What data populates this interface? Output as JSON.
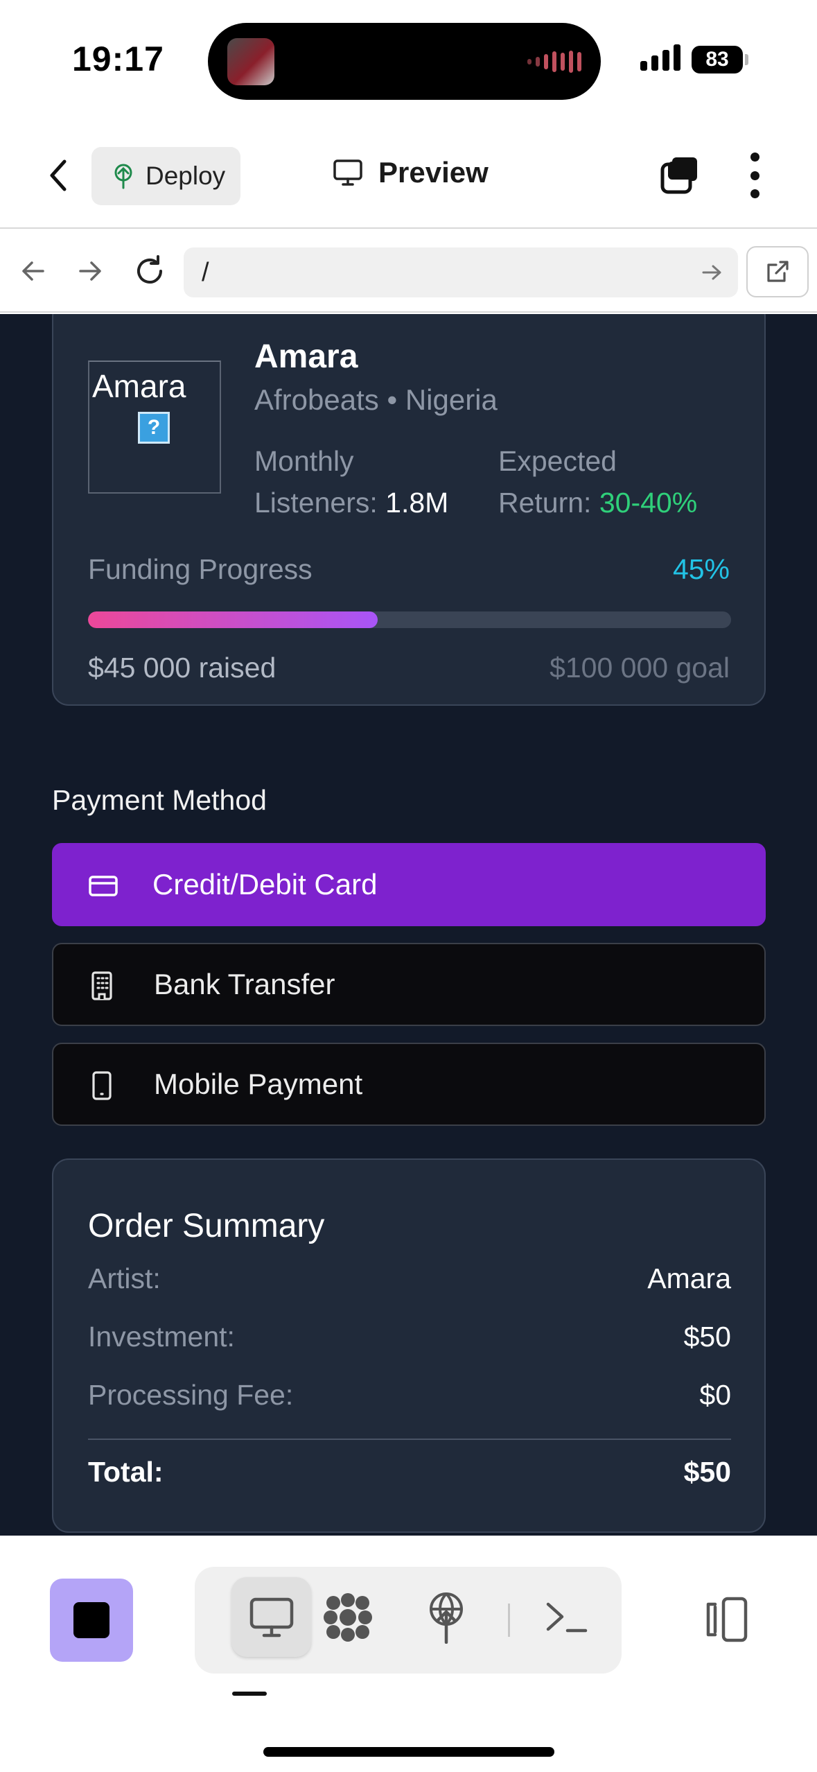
{
  "status_bar": {
    "time": "19:17",
    "battery": "83"
  },
  "app_toolbar": {
    "deploy_label": "Deploy",
    "preview_label": "Preview"
  },
  "browser": {
    "url": "/"
  },
  "artist": {
    "image_alt": "Amara",
    "name": "Amara",
    "meta": "Afrobeats • Nigeria",
    "listeners_label_1": "Monthly",
    "listeners_label_2": "Listeners:",
    "listeners_value": "1.8M",
    "return_label_1": "Expected",
    "return_label_2": "Return:",
    "return_value": "30-40%",
    "funding_label": "Funding Progress",
    "funding_percent": "45%",
    "funding_fraction": 0.45,
    "raised": "$45 000 raised",
    "goal": "$100 000 goal"
  },
  "payment": {
    "label": "Payment Method",
    "options": [
      {
        "label": "Credit/Debit Card",
        "icon": "credit-card-icon",
        "selected": true
      },
      {
        "label": "Bank Transfer",
        "icon": "building-icon",
        "selected": false
      },
      {
        "label": "Mobile Payment",
        "icon": "smartphone-icon",
        "selected": false
      }
    ]
  },
  "order_summary": {
    "title": "Order Summary",
    "rows": [
      {
        "key": "Artist:",
        "value": "Amara"
      },
      {
        "key": "Investment:",
        "value": "$50"
      },
      {
        "key": "Processing Fee:",
        "value": "$0"
      }
    ],
    "total_key": "Total:",
    "total_value": "$50"
  },
  "colors": {
    "page_bg": "#121a29",
    "card_bg": "#202a3a",
    "accent_purple": "#7e22ce",
    "progress_start": "#ec4899",
    "progress_end": "#a855f7",
    "percent_cyan": "#22c3e6",
    "return_green": "#2fd07a",
    "stop_button": "#b4a4f7"
  }
}
